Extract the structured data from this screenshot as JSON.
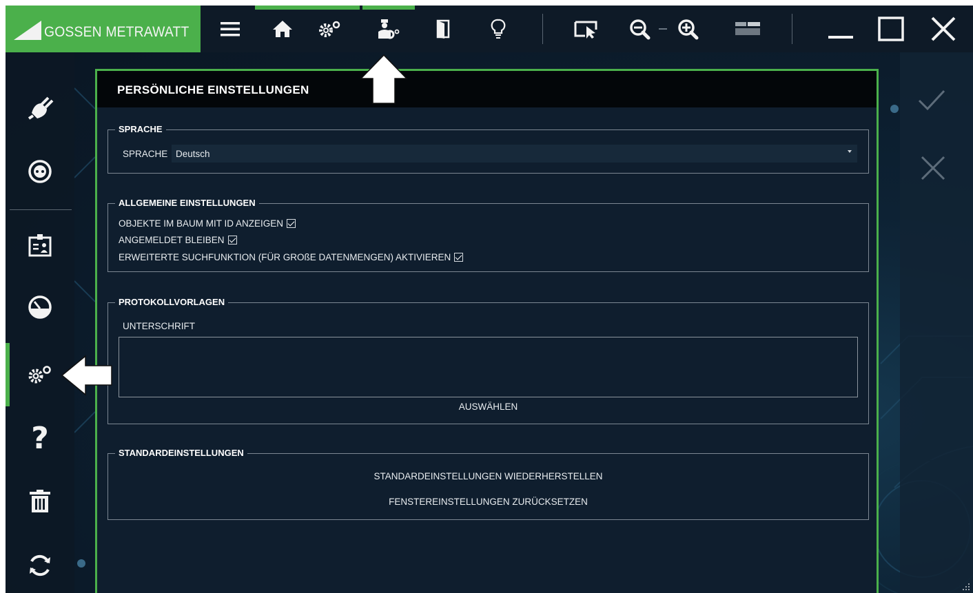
{
  "brand": {
    "name": "GOSSEN METRAWATT",
    "color": "#4bb04b"
  },
  "toolbar": {
    "icons": [
      "menu-icon",
      "home-icon",
      "settings-icon",
      "user-settings-icon",
      "door-icon",
      "lightbulb-icon",
      "select-cursor-icon",
      "zoom-out-icon",
      "zoom-in-icon",
      "panel-layout-icon"
    ],
    "window_controls": [
      "minimize-icon",
      "maximize-icon",
      "close-icon"
    ]
  },
  "sidebar": {
    "items": [
      "plug-icon",
      "socket-icon",
      "id-card-icon",
      "gauge-icon",
      "settings-icon",
      "help-icon",
      "trash-icon",
      "sync-icon"
    ],
    "help_glyph": "?",
    "active": "settings-icon"
  },
  "rightbar": {
    "items": [
      "check-icon",
      "cancel-icon"
    ]
  },
  "panel": {
    "title": "PERSÖNLICHE EINSTELLUNGEN",
    "language_group": {
      "legend": "SPRACHE",
      "label": "SPRACHE",
      "value": "Deutsch"
    },
    "general_group": {
      "legend": "ALLGEMEINE EINSTELLUNGEN",
      "options": [
        {
          "label": "OBJEKTE IM BAUM MIT ID ANZEIGEN",
          "checked": true
        },
        {
          "label": "ANGEMELDET BLEIBEN",
          "checked": true
        },
        {
          "label": "ERWEITERTE SUCHFUNKTION (FÜR GROßE DATENMENGEN) AKTIVIEREN",
          "checked": true
        }
      ]
    },
    "templates_group": {
      "legend": "PROTOKOLLVORLAGEN",
      "signature_label": "UNTERSCHRIFT",
      "select_button": "AUSWÄHLEN"
    },
    "defaults_group": {
      "legend": "STANDARDEINSTELLUNGEN",
      "restore_button": "STANDARDEINSTELLUNGEN WIEDERHERSTELLEN",
      "reset_window_button": "FENSTEREINSTELLUNGEN ZURÜCKSETZEN"
    }
  }
}
